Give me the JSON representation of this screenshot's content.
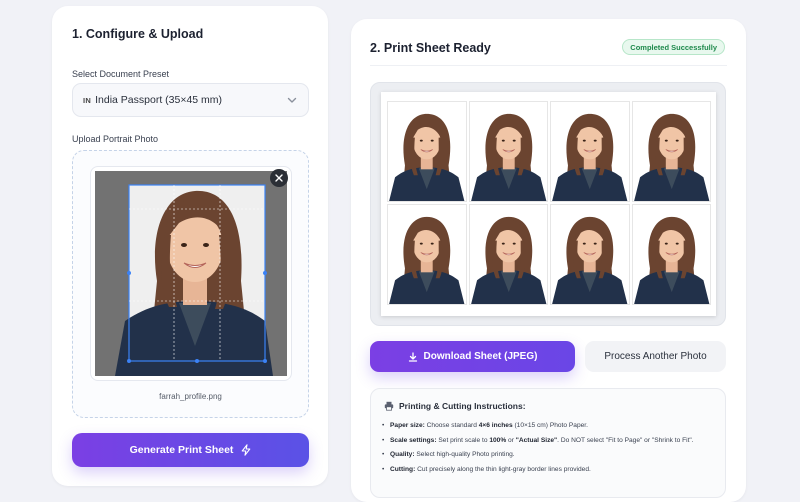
{
  "left_panel": {
    "title": "1. Configure & Upload",
    "preset_label": "Select Document Preset",
    "preset_value": "India Passport (35×45 mm)",
    "preset_flag": "IN",
    "upload_label": "Upload Portrait Photo",
    "file_name": "farrah_profile.png",
    "generate_button": "Generate Print Sheet"
  },
  "right_panel": {
    "title": "2. Print Sheet Ready",
    "status_badge": "Completed Successfully",
    "download_button": "Download Sheet (JPEG)",
    "process_button": "Process Another Photo",
    "instructions": {
      "title": "Printing & Cutting Instructions:",
      "items": [
        {
          "label": "Paper size:",
          "a": " Choose standard ",
          "b": "4×6 inches",
          "c": " (10×15 cm) Photo Paper."
        },
        {
          "label": "Scale settings:",
          "a": " Set print scale to ",
          "b": "100%",
          "c": " or ",
          "d": "\"Actual Size\"",
          "e": ". Do NOT select \"Fit to Page\" or \"Shrink to Fit\"."
        },
        {
          "label": "Quality:",
          "a": " Select high-quality Photo printing."
        },
        {
          "label": "Cutting:",
          "a": " Cut precisely along the thin light-gray border lines provided."
        }
      ]
    }
  },
  "colors": {
    "accent": "#6d45e6",
    "success": "#1f8a4c"
  },
  "icons": [
    "chevron-down-icon",
    "close-icon",
    "lightning-icon",
    "download-icon",
    "printer-icon"
  ]
}
